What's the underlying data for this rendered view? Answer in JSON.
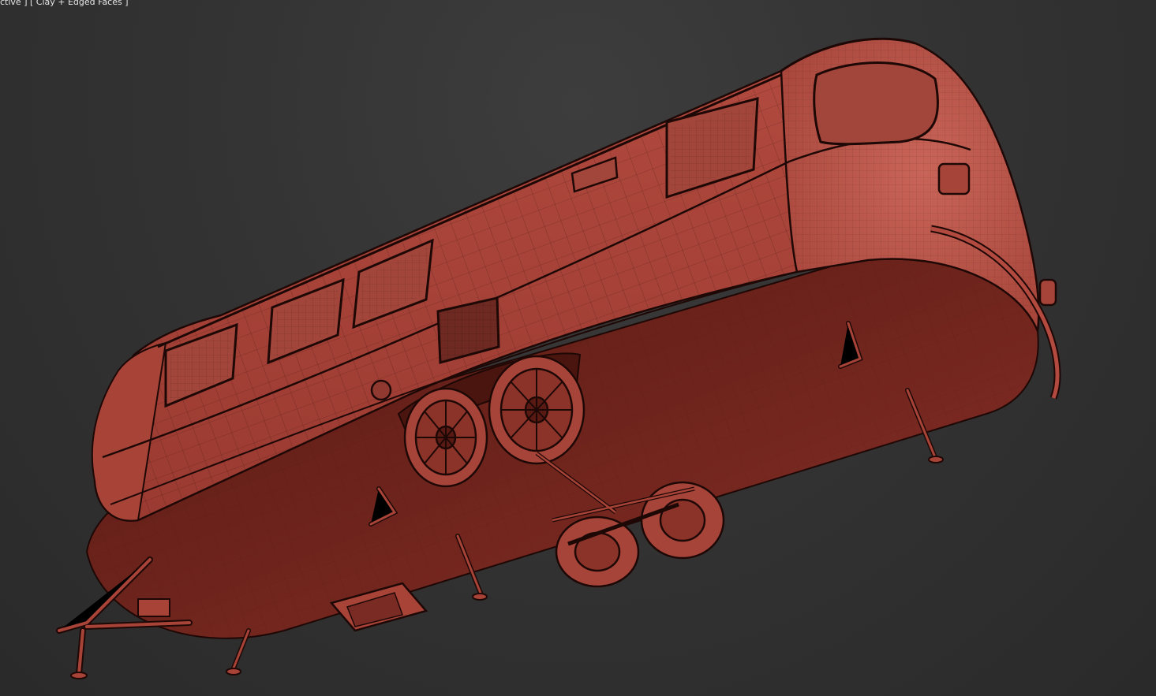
{
  "viewport": {
    "label": "ctive ] [ Clay + Edged Faces ]",
    "background_color": "#333333",
    "clay_color": "#b54b40",
    "wire_color": "#1e0806"
  },
  "scene": {
    "model": "vintage-travel-trailer",
    "render_mode": "clay-edged-faces"
  }
}
